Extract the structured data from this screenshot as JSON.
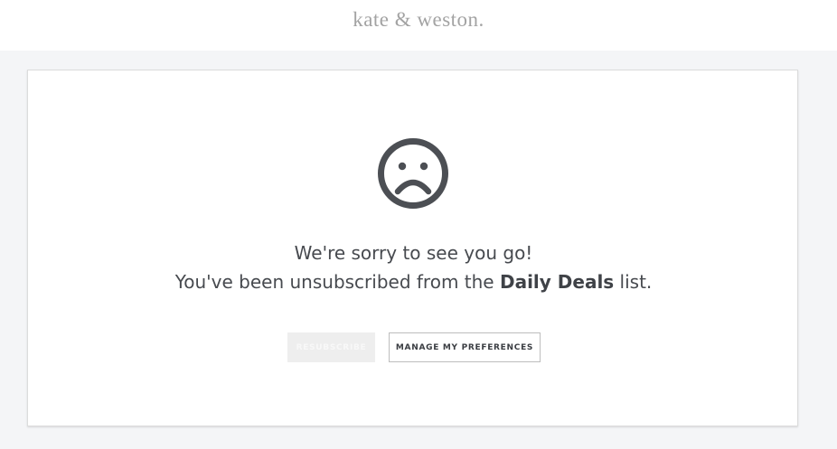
{
  "header": {
    "logo_text": "kate & weston."
  },
  "card": {
    "icon": "sad-face-icon",
    "message_line1": "We're sorry to see you go!",
    "message_line2_prefix": "You've been unsubscribed from the ",
    "list_name": "Daily Deals",
    "message_line2_suffix": " list."
  },
  "buttons": {
    "resubscribe_label": "RESUBSCRIBE",
    "manage_preferences_label": "MANAGE MY PREFERENCES"
  },
  "colors": {
    "background": "#f4f5f7",
    "icon": "#4c4f54",
    "text": "#474a4f"
  }
}
